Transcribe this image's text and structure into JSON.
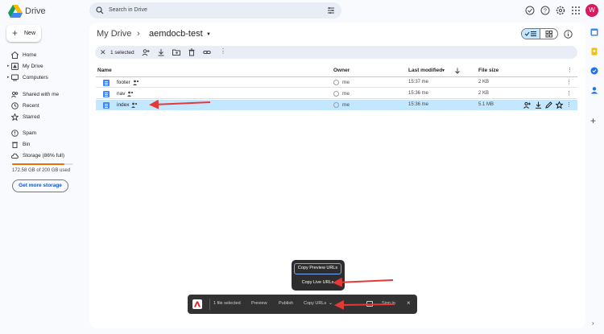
{
  "app": {
    "title": "Drive"
  },
  "search": {
    "placeholder": "Search in Drive"
  },
  "user": {
    "avatar_letter": "W",
    "avatar_color": "#d81b60"
  },
  "sidebar": {
    "new_label": "New",
    "items": [
      {
        "label": "Home",
        "icon": "home-icon"
      },
      {
        "label": "My Drive",
        "icon": "drive-icon"
      },
      {
        "label": "Computers",
        "icon": "computer-icon"
      },
      {
        "label": "Shared with me",
        "icon": "people-icon"
      },
      {
        "label": "Recent",
        "icon": "clock-icon"
      },
      {
        "label": "Starred",
        "icon": "star-icon"
      },
      {
        "label": "Spam",
        "icon": "spam-icon"
      },
      {
        "label": "Bin",
        "icon": "bin-icon"
      },
      {
        "label": "Storage (86% full)",
        "icon": "cloud-icon"
      }
    ],
    "storage_fraction": 0.86,
    "storage_used": "172.58 GB of 200 GB used",
    "get_more": "Get more storage"
  },
  "breadcrumb": {
    "root": "My Drive",
    "separator": "›",
    "folder": "aemdocb-test"
  },
  "selection": {
    "count_label": "1 selected"
  },
  "table": {
    "columns": {
      "name": "Name",
      "owner": "Owner",
      "modified": "Last modified",
      "size": "File size"
    },
    "rows": [
      {
        "name": "footer",
        "owner": "me",
        "modified": "15:37 me",
        "size": "2 KB",
        "selected": false
      },
      {
        "name": "nav",
        "owner": "me",
        "modified": "15:36 me",
        "size": "2 KB",
        "selected": false
      },
      {
        "name": "index",
        "owner": "me",
        "modified": "15:36 me",
        "size": "5.1 MB",
        "selected": true
      }
    ]
  },
  "popup": {
    "preview": "Copy Preview URLs",
    "live": "Copy Live URLs"
  },
  "toolbar": {
    "file_selected": "1 file selected",
    "preview": "Preview",
    "publish": "Publish",
    "copy_urls": "Copy URLs",
    "sign_in": "Sign in",
    "close": "×"
  },
  "colors": {
    "selected_row": "#c2e7ff",
    "accent": "#0b57d0",
    "storage": "#e37400",
    "arrow": "#e53935"
  }
}
